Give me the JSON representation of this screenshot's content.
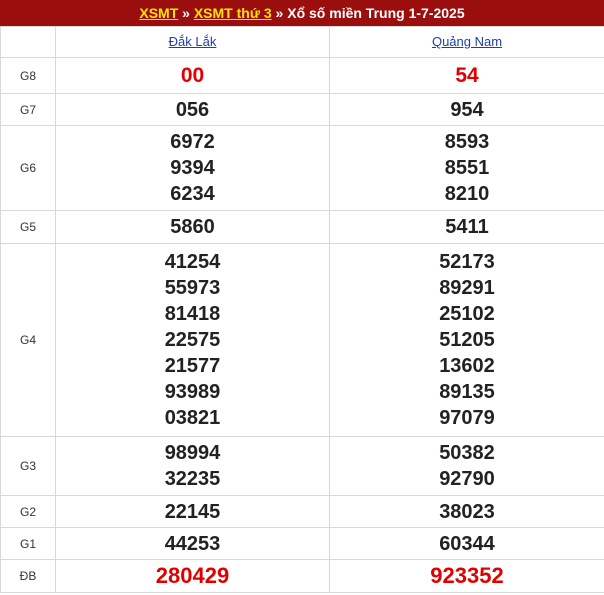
{
  "header": {
    "link1": "XSMT",
    "sep1": " » ",
    "link2": "XSMT thứ 3",
    "sep2": " » ",
    "title": "Xổ số miền Trung 1-7-2025"
  },
  "provinces": [
    "Đắk Lắk",
    "Quảng Nam"
  ],
  "rows": [
    {
      "label": "G8",
      "values": [
        [
          "00"
        ],
        [
          "54"
        ]
      ]
    },
    {
      "label": "G7",
      "values": [
        [
          "056"
        ],
        [
          "954"
        ]
      ]
    },
    {
      "label": "G6",
      "values": [
        [
          "6972",
          "9394",
          "6234"
        ],
        [
          "8593",
          "8551",
          "8210"
        ]
      ]
    },
    {
      "label": "G5",
      "values": [
        [
          "5860"
        ],
        [
          "5411"
        ]
      ]
    },
    {
      "label": "G4",
      "values": [
        [
          "41254",
          "55973",
          "81418",
          "22575",
          "21577",
          "93989",
          "03821"
        ],
        [
          "52173",
          "89291",
          "25102",
          "51205",
          "13602",
          "89135",
          "97079"
        ]
      ]
    },
    {
      "label": "G3",
      "values": [
        [
          "98994",
          "32235"
        ],
        [
          "50382",
          "92790"
        ]
      ]
    },
    {
      "label": "G2",
      "values": [
        [
          "22145"
        ],
        [
          "38023"
        ]
      ]
    },
    {
      "label": "G1",
      "values": [
        [
          "44253"
        ],
        [
          "60344"
        ]
      ]
    },
    {
      "label": "ĐB",
      "values": [
        [
          "280429"
        ],
        [
          "923352"
        ]
      ]
    }
  ],
  "colors": {
    "header_bg": "#9b0e0e",
    "link": "#ffe500",
    "highlight": "#e00000",
    "province": "#1d3fa7"
  }
}
